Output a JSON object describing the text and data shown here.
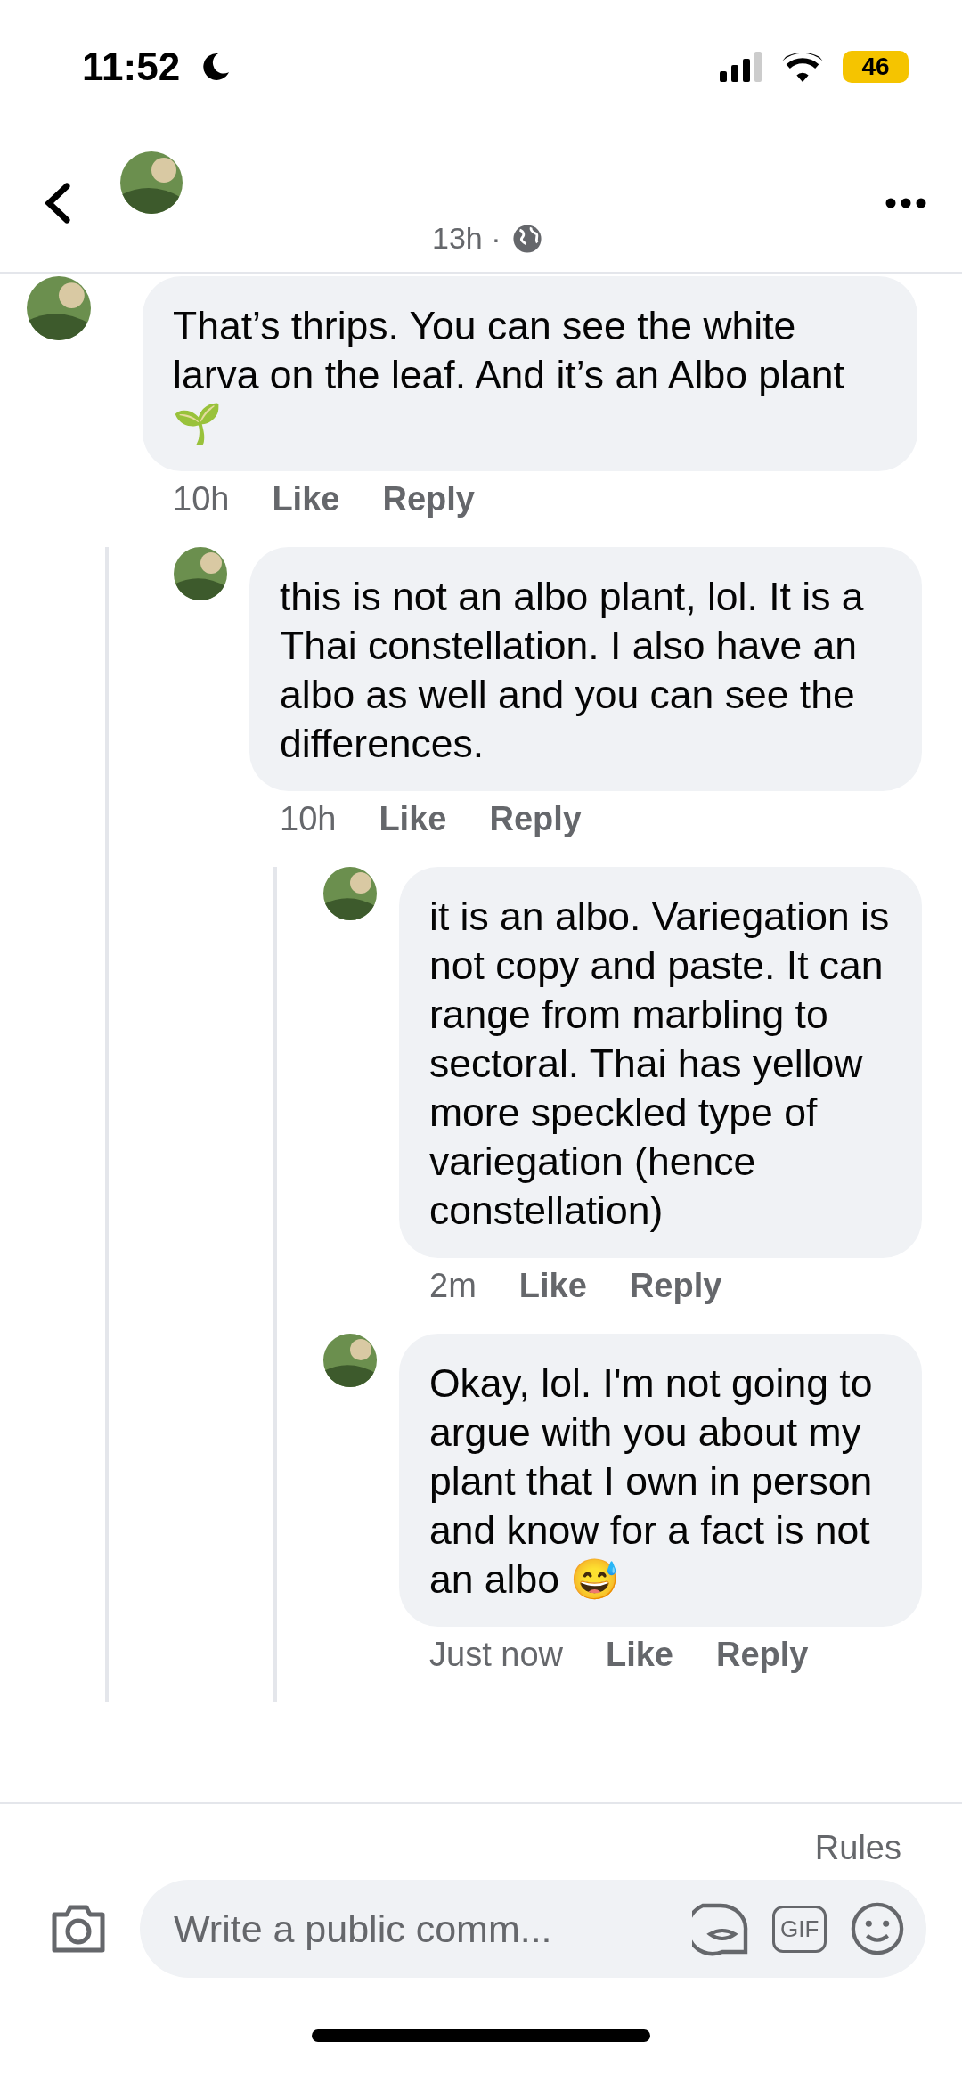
{
  "status_bar": {
    "time": "11:52",
    "battery": "46"
  },
  "header": {
    "time": "13h ·"
  },
  "comments": [
    {
      "text": "That’s thrips. You can see the white larva on the leaf. And it’s an Albo plant 🌱",
      "time": "10h",
      "like": "Like",
      "reply": "Reply",
      "children": [
        {
          "text": "this is not an albo plant, lol. It is a Thai constellation. I also have an albo as well and you can see the differences.",
          "time": "10h",
          "like": "Like",
          "reply": "Reply",
          "children": [
            {
              "text": "it is an albo. Variegation is not copy and paste. It can range from marbling to sectoral. Thai has yellow more speckled type of variegation (hence constellation)",
              "time": "2m",
              "like": "Like",
              "reply": "Reply"
            },
            {
              "text": "Okay, lol. I'm not going to argue with you about my plant that I own in person and know for a fact is not an albo 😅",
              "time": "Just now",
              "like": "Like",
              "reply": "Reply"
            }
          ]
        }
      ]
    }
  ],
  "footer": {
    "rules": "Rules",
    "placeholder": "Write a public comm...",
    "gif": "GIF"
  }
}
